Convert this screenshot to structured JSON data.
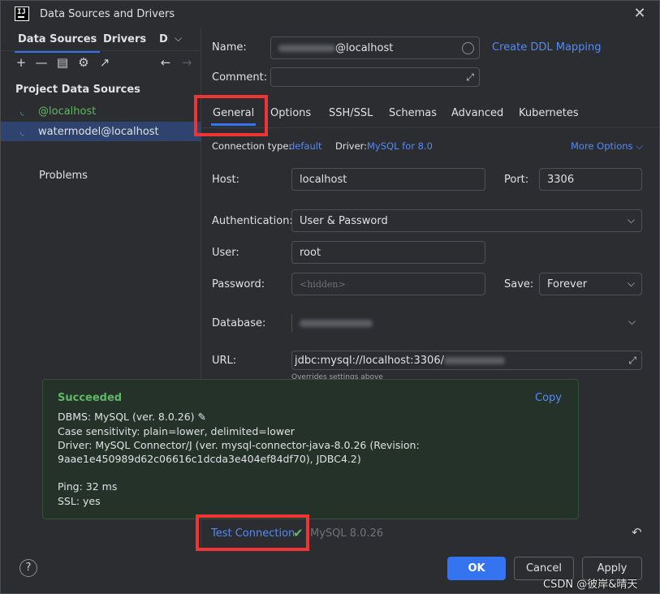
{
  "window": {
    "title": "Data Sources and Drivers",
    "app_icon_text": "IJ"
  },
  "left": {
    "tabs": [
      "Data Sources",
      "Drivers",
      "DI"
    ],
    "section_title": "Project Data Sources",
    "items": [
      {
        "label": "@localhost",
        "color": "#5fb865"
      },
      {
        "label": "watermodel@localhost"
      }
    ],
    "problems": "Problems"
  },
  "form": {
    "name_label": "Name:",
    "name_value": "@localhost",
    "create_ddl": "Create DDL Mapping",
    "comment_label": "Comment:",
    "tabs": [
      "General",
      "Options",
      "SSH/SSL",
      "Schemas",
      "Advanced",
      "Kubernetes"
    ],
    "conn_type_label": "Connection type:",
    "conn_type_value": "default",
    "driver_label": "Driver:",
    "driver_value": "MySQL for 8.0",
    "more_options": "More Options",
    "host_label": "Host:",
    "host_value": "localhost",
    "port_label": "Port:",
    "port_value": "3306",
    "auth_label": "Authentication:",
    "auth_value": "User & Password",
    "user_label": "User:",
    "user_value": "root",
    "password_label": "Password:",
    "password_placeholder": "<hidden>",
    "save_label": "Save:",
    "save_value": "Forever",
    "database_label": "Database:",
    "url_label": "URL:",
    "url_value": "jdbc:mysql://localhost:3306/",
    "url_hint": "Overrides settings above"
  },
  "popup": {
    "title": "Succeeded",
    "copy": "Copy",
    "lines": [
      "DBMS: MySQL (ver. 8.0.26)",
      "Case sensitivity: plain=lower, delimited=lower",
      "Driver: MySQL Connector/J (ver. mysql-connector-java-8.0.26 (Revision:",
      "9aae1e450989d62c06616c1dcda3e404ef84df70), JDBC4.2)",
      "Ping: 32 ms",
      "SSL: yes"
    ]
  },
  "bottom": {
    "test_connection": "Test Connection",
    "mysql_version": "MySQL 8.0.26",
    "ok": "OK",
    "cancel": "Cancel",
    "apply": "Apply",
    "help": "?"
  },
  "watermark": "CSDN @彼岸&晴天",
  "colors": {
    "accent": "#3574f0",
    "link": "#548af7",
    "success": "#5fb865",
    "highlight": "#ef3434"
  }
}
